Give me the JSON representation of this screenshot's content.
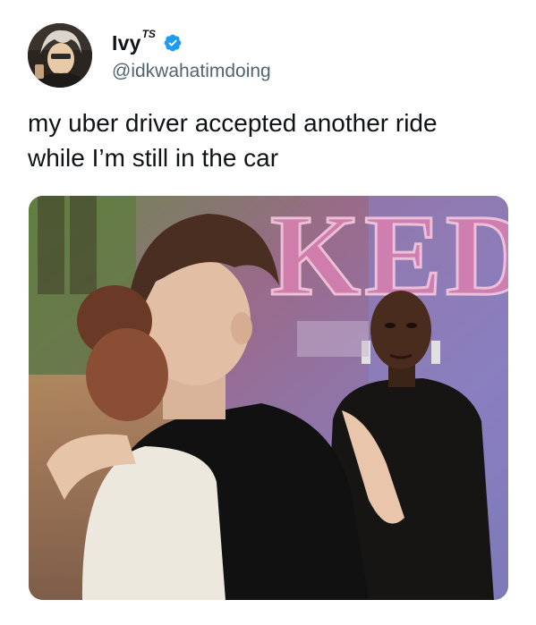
{
  "author": {
    "display_name": "Ivy",
    "display_name_sup": "TS",
    "handle": "@idkwahatimdoing",
    "verified": true,
    "verified_icon": "verified-badge-icon",
    "verified_color": "#1d9bf0"
  },
  "tweet": {
    "text_line1": "my uber driver accepted another ride",
    "text_line2": "while I’m still in the car"
  },
  "media": {
    "backdrop_lettering": "WICKED",
    "backdrop_lettering_partial": "KED"
  },
  "colors": {
    "text": "#0f1419",
    "secondary": "#536471",
    "accent": "#1d9bf0"
  }
}
